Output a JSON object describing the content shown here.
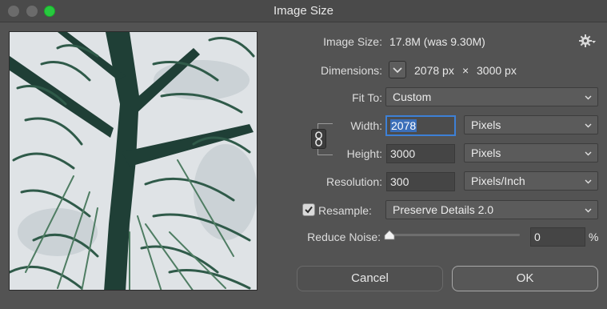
{
  "window": {
    "title": "Image Size"
  },
  "info": {
    "image_size_label": "Image Size:",
    "image_size_value": "17.8M (was 9.30M)",
    "dimensions_label": "Dimensions:",
    "dimensions_width": "2078 px",
    "dimensions_times": "×",
    "dimensions_height": "3000 px"
  },
  "fit_to": {
    "label": "Fit To:",
    "value": "Custom"
  },
  "width": {
    "label": "Width:",
    "value": "2078",
    "unit": "Pixels"
  },
  "height": {
    "label": "Height:",
    "value": "3000",
    "unit": "Pixels"
  },
  "resolution": {
    "label": "Resolution:",
    "value": "300",
    "unit": "Pixels/Inch"
  },
  "resample": {
    "label": "Resample:",
    "checked": true,
    "value": "Preserve Details 2.0"
  },
  "reduce_noise": {
    "label": "Reduce Noise:",
    "value": "0",
    "unit": "%"
  },
  "buttons": {
    "cancel": "Cancel",
    "ok": "OK"
  },
  "icons": {
    "settings": "gear-icon",
    "link": "link-chain-icon",
    "dimensions_menu": "chevron-down-icon"
  },
  "colors": {
    "background": "#535353",
    "focus": "#3d80d6",
    "selection": "#3b6fb9",
    "zoom": "#27c93f"
  }
}
